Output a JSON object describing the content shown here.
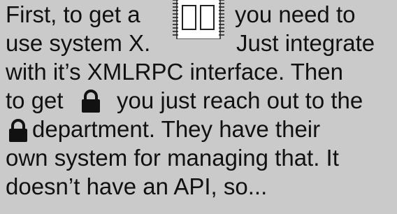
{
  "lines": [
    {
      "a": "First, to get a",
      "b": "you need to"
    },
    {
      "a": "use system X.",
      "b": "Just integrate"
    },
    {
      "a": "with it’s XMLRPC interface. Then"
    },
    {
      "a": "to get",
      "b": "you just reach out to the"
    },
    {
      "b": "department. They have their"
    },
    {
      "a": "own system for managing that. It"
    },
    {
      "a": "doesn’t have an API, so..."
    }
  ],
  "icons": {
    "chip": "chip-icon",
    "lock": "padlock-icon"
  },
  "colors": {
    "background": "#cacaca",
    "text": "#111111"
  }
}
